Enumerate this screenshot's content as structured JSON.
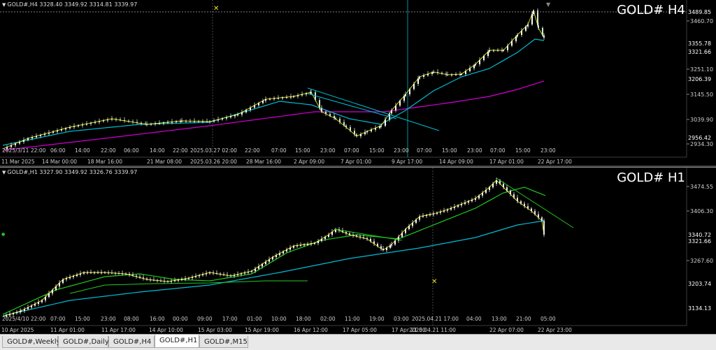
{
  "pane1": {
    "header": "GOLD#,H4  3328.40 3349.92 3314.81 3339.97",
    "title": "GOLD# H4",
    "price_labels": [
      "3460.70",
      "3251.10",
      "3145.50",
      "3039.90",
      "2934.30"
    ],
    "hlines": [
      "3489.85",
      "3355.78",
      "3321.66",
      "3206.39",
      "2956.42"
    ],
    "time_labels": [
      "11 Mar 2025",
      "14 Mar 00:00",
      "18 Mar 16:00",
      "21 Mar 08:00",
      "2025.03.26 20:00",
      "28 Mar 16:00",
      "2 Apr 09:00",
      "7 Apr 01:00",
      "9 Apr 17:00",
      "14 Apr 09:00",
      "17 Apr 01:00",
      "22 Apr 17:00"
    ],
    "inner_time_labels": [
      "2025/3/11 22:00",
      "06:00",
      "14:00",
      "22:00",
      "06:00",
      "14:00",
      "22:00",
      "2025.03.27 02:00",
      "22:00",
      "07:00",
      "15:00",
      "23:00",
      "07:00",
      "15:00",
      "23:00",
      "07:00",
      "15:00",
      "23:00",
      "07:00",
      "15:00",
      "23:00"
    ]
  },
  "pane2": {
    "header": "GOLD#,H1  3327.90 3349.92 3326.76 3339.97",
    "title": "GOLD# H1",
    "price_labels": [
      "3474.55",
      "3406.30",
      "3267.60"
    ],
    "hlines": [
      "3340.72",
      "3321.66",
      "3203.74",
      "3134.13"
    ],
    "time_labels": [
      "10 Apr 2025",
      "11 Apr 01:00",
      "11 Apr 17:00",
      "14 Apr 10:00",
      "15 Apr 03:00",
      "15 Apr 19:00",
      "16 Apr 12:00",
      "17 Apr 05:00",
      "17 Apr 21:00",
      "2025.04.21 11:00",
      "22 Apr 07:00",
      "22 Apr 23:00"
    ],
    "inner_time_labels": [
      "2025/4/10 22:00",
      "07:00",
      "15:00",
      "23:00",
      "08:00",
      "16:00",
      "00:00",
      "09:00",
      "17:00",
      "01:00",
      "10:00",
      "18:00",
      "02:00",
      "11:00",
      "19:00",
      "03:00",
      "2025.04.21 17:00",
      "04:00",
      "13:00",
      "21:00",
      "05:00"
    ]
  },
  "tabs": [
    {
      "label": "GOLD#,Weekly",
      "active": false
    },
    {
      "label": "GOLD#,Daily",
      "active": false
    },
    {
      "label": "GOLD#,H4",
      "active": false
    },
    {
      "label": "GOLD#,H1",
      "active": true
    },
    {
      "label": "GOLD#,M15",
      "active": false
    }
  ],
  "colors": {
    "grid_line": "#00b7c3",
    "ma_fast": "#00bcd4",
    "ma_slow": "#d400d4",
    "candle": "#e6e61a",
    "ma_green": "#22c922",
    "text": "#cccccc"
  }
}
